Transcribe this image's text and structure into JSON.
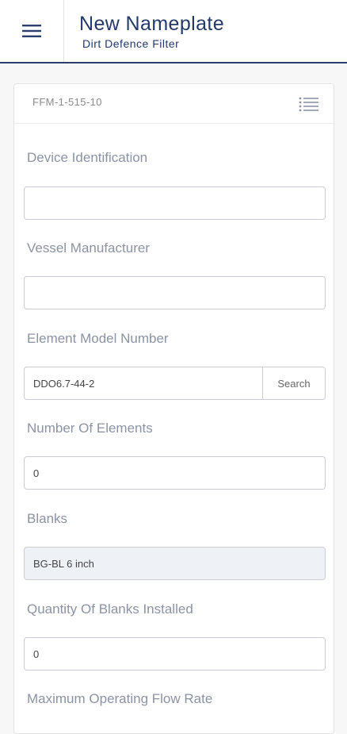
{
  "header": {
    "title": "New Nameplate",
    "subtitle": "Dirt Defence Filter",
    "menu_icon": "hamburger-menu-icon"
  },
  "card": {
    "code": "FFM-1-515-10",
    "list_icon": "list-icon"
  },
  "form": {
    "device_identification": {
      "label": "Device Identification",
      "value": ""
    },
    "vessel_manufacturer": {
      "label": "Vessel Manufacturer",
      "value": ""
    },
    "element_model_number": {
      "label": "Element Model Number",
      "value": "DDO6.7-44-2",
      "button_label": "Search"
    },
    "number_of_elements": {
      "label": "Number Of Elements",
      "value": "0"
    },
    "blanks": {
      "label": "Blanks",
      "value": "BG-BL 6 inch"
    },
    "quantity_of_blanks_installed": {
      "label": "Quantity Of Blanks Installed",
      "value": "0"
    },
    "maximum_operating_flow_rate": {
      "label": "Maximum Operating Flow Rate"
    }
  },
  "colors": {
    "primary": "#23396a",
    "label": "#8b93a3",
    "border": "#c9ccd3",
    "readonly_bg": "#eef1f6"
  }
}
